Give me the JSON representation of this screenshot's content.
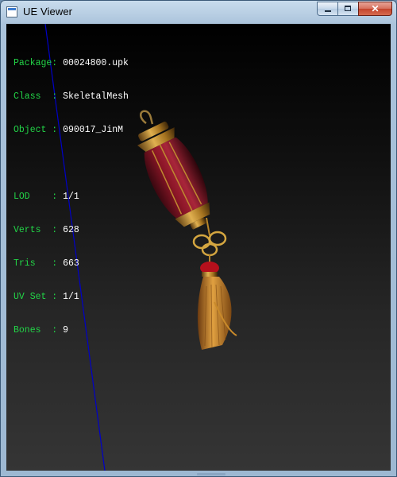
{
  "window": {
    "title": "UE Viewer",
    "buttons": {
      "minimize": "minimize",
      "maximize": "maximize",
      "close": "✕"
    }
  },
  "info": {
    "group1": [
      {
        "key": "Package: ",
        "value": "00024800.upk"
      },
      {
        "key": "Class  : ",
        "value": "SkeletalMesh"
      },
      {
        "key": "Object : ",
        "value": "090017_JinM"
      }
    ],
    "group2": [
      {
        "key": "LOD    : ",
        "value": "1/1"
      },
      {
        "key": "Verts  : ",
        "value": "628"
      },
      {
        "key": "Tris   : ",
        "value": "663"
      },
      {
        "key": "UV Set : ",
        "value": "1/1"
      },
      {
        "key": "Bones  : ",
        "value": "9"
      }
    ]
  },
  "colors": {
    "label": "#22d447",
    "value": "#ffffff",
    "axis": "#0000c8",
    "lantern_body": "#7a1020",
    "lantern_gold": "#b8862a",
    "tassel": "#c98a2a"
  },
  "icons": {
    "app": "app-window-icon",
    "model": "chinese-lantern-mesh"
  }
}
